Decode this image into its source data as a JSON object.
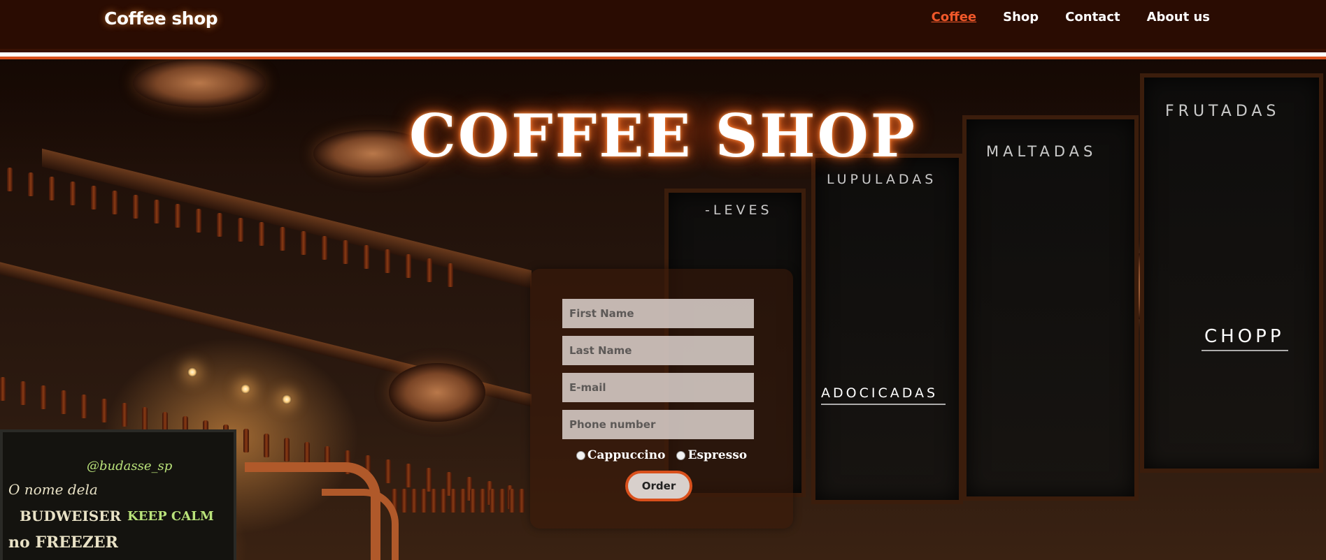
{
  "navbar": {
    "brand": "Coffee shop",
    "links": [
      {
        "label": "Coffee",
        "active": true
      },
      {
        "label": "Shop",
        "active": false
      },
      {
        "label": "Contact",
        "active": false
      },
      {
        "label": "About us",
        "active": false
      }
    ]
  },
  "hero": {
    "title": "COFFEE SHOP"
  },
  "form": {
    "first_name_placeholder": "First Name",
    "last_name_placeholder": "Last Name",
    "email_placeholder": "E-mail",
    "phone_placeholder": "Phone number",
    "options": [
      "Cappuccino",
      "Espresso"
    ],
    "order_label": "Order"
  },
  "background": {
    "boards": {
      "frutadas": "FRUTADAS",
      "maltadas": "MALTADAS",
      "lupuladas": "LUPULADAS",
      "leves": "-LEVES",
      "adocicadas": "ADOCICADAS",
      "chopp": "CHOPP"
    },
    "chalkboard": {
      "line1": "@budasse_sp",
      "line2": "O nome dela",
      "line3": "BUDWEISER",
      "line4": "KEEP CALM",
      "line5": "no FREEZER"
    }
  },
  "colors": {
    "nav_bg": "#2a0c02",
    "accent": "#d9501c",
    "active_link": "#f0582a"
  }
}
